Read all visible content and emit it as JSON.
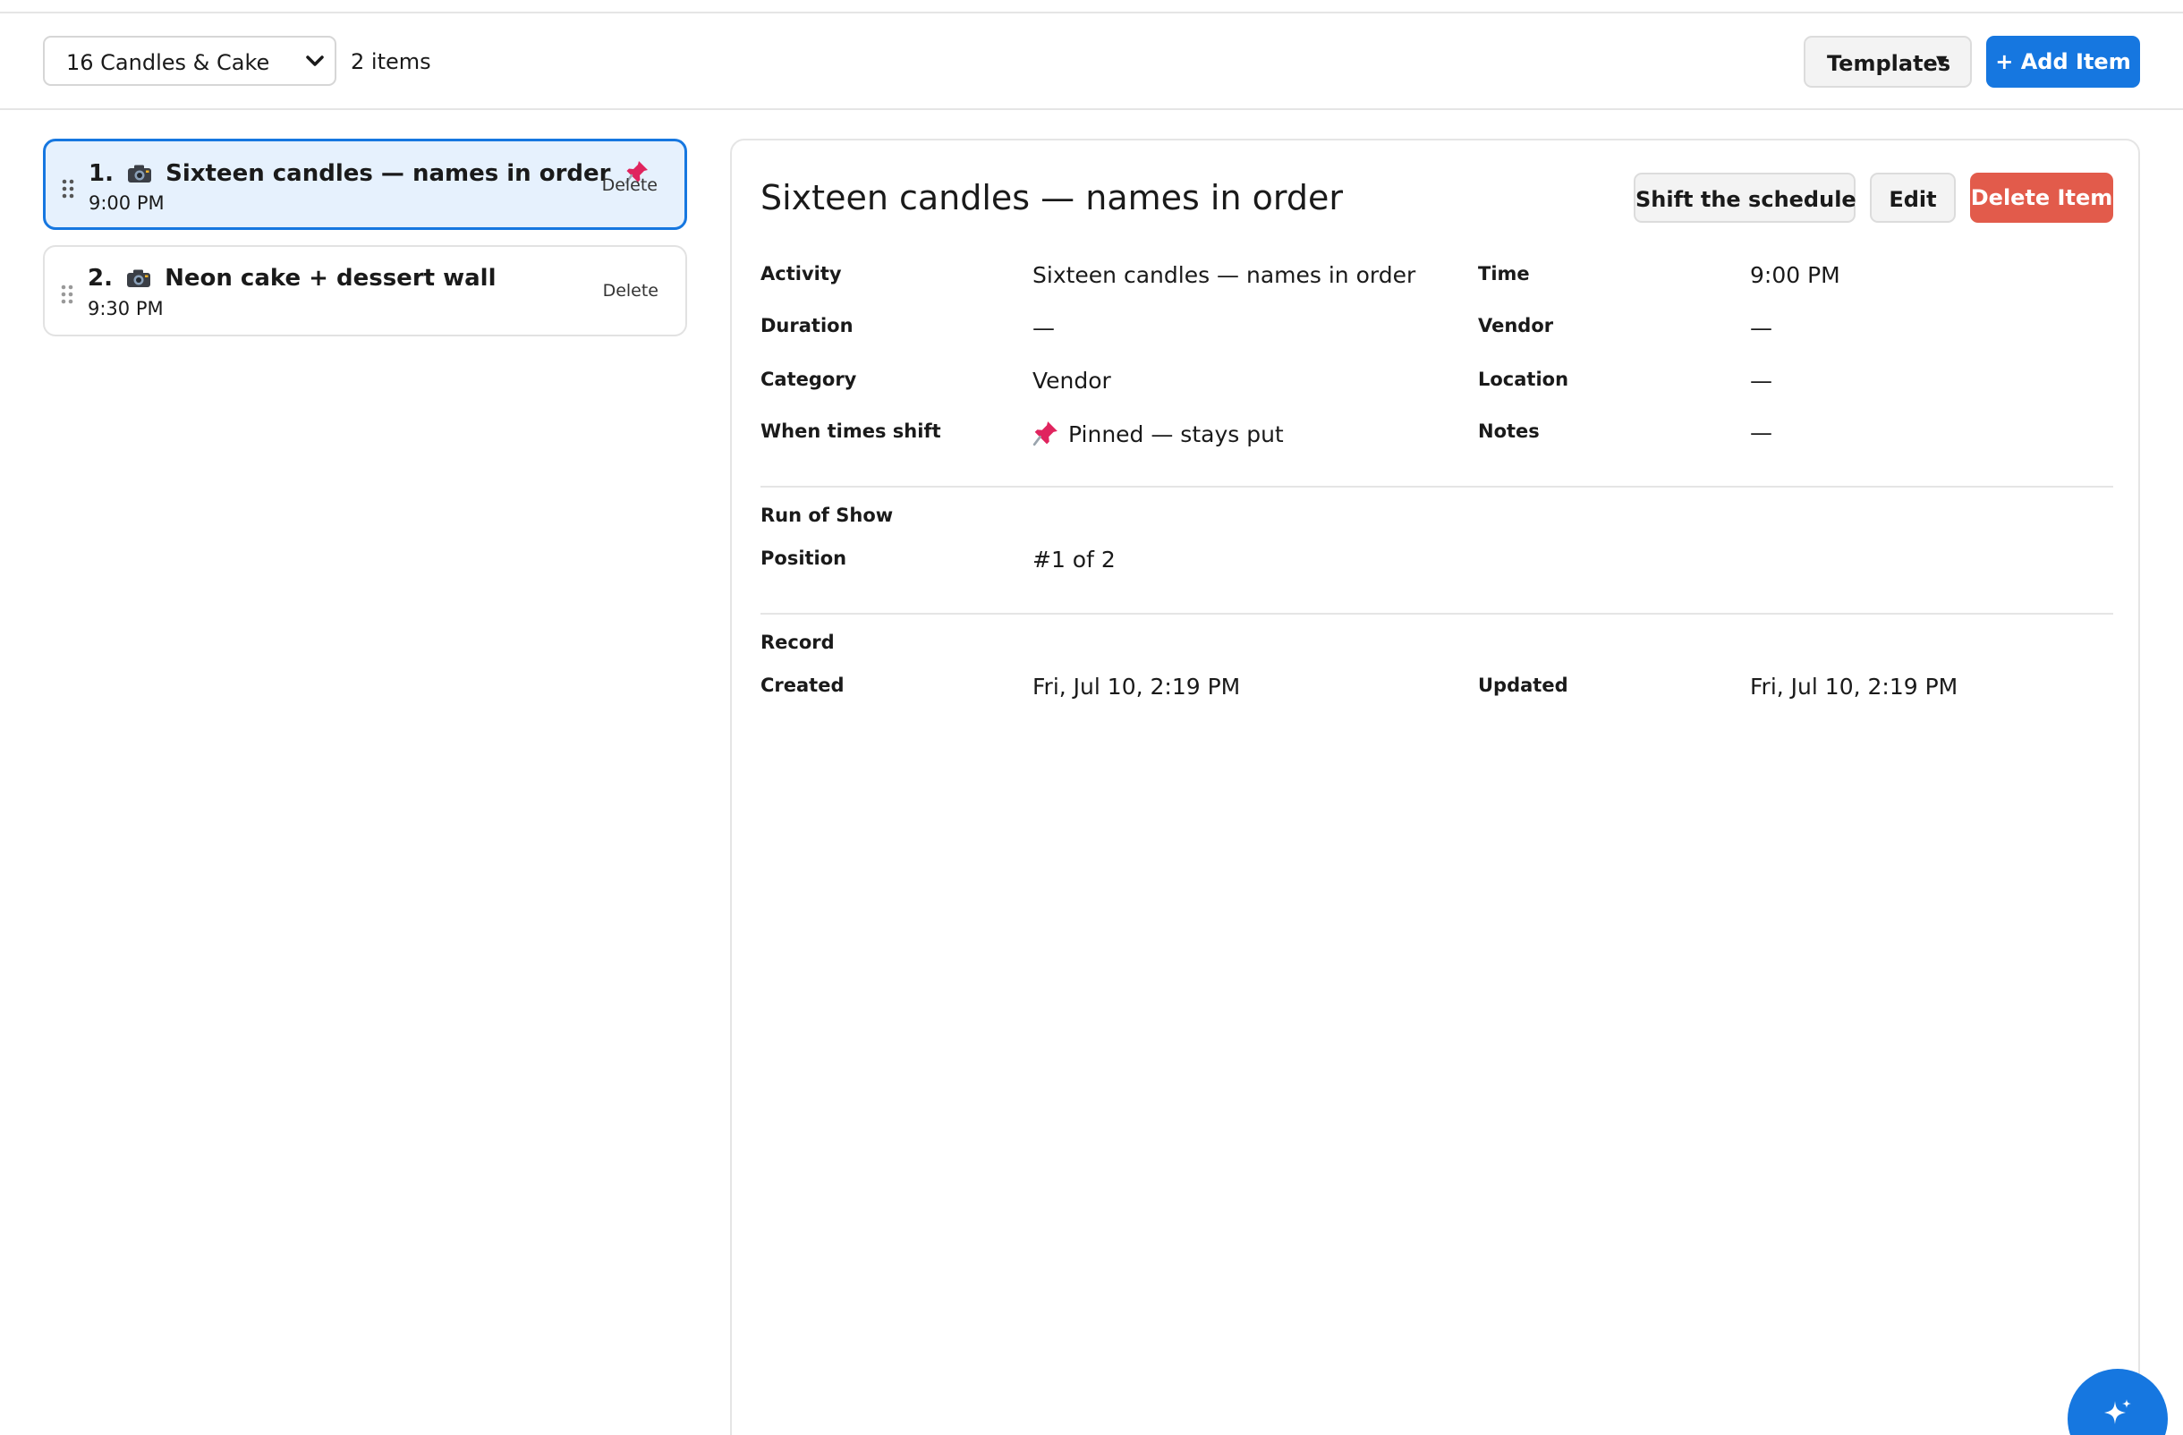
{
  "toolbar": {
    "event_select": "16 Candles & Cake",
    "item_count": "2 items",
    "templates_label": "Templates",
    "templates_caret": "▼",
    "add_label": "+ Add Item"
  },
  "items": [
    {
      "number": "1.",
      "title": "Sixteen candles — names in order",
      "time": "9:00 PM",
      "delete": "Delete",
      "icon": "camera-icon",
      "pinned": true
    },
    {
      "number": "2.",
      "title": "Neon cake + dessert wall",
      "time": "9:30 PM",
      "delete": "Delete",
      "icon": "camera-icon",
      "pinned": false
    }
  ],
  "detail": {
    "title": "Sixteen candles — names in order",
    "buttons": {
      "shift": "Shift the schedule",
      "edit": "Edit",
      "delete": "Delete Item"
    },
    "fields": {
      "activity_label": "Activity",
      "activity": "Sixteen candles — names in order",
      "time_label": "Time",
      "time": "9:00 PM",
      "duration_label": "Duration",
      "duration": "—",
      "vendor_label": "Vendor",
      "vendor": "—",
      "category_label": "Category",
      "category": "Vendor",
      "location_label": "Location",
      "location": "—",
      "shift_label": "When times shift",
      "shift": "Pinned — stays put",
      "notes_label": "Notes",
      "notes": "—"
    },
    "run_of_show": {
      "heading": "Run of Show",
      "position_label": "Position",
      "position": "#1 of 2"
    },
    "record": {
      "heading": "Record",
      "created_label": "Created",
      "created": "Fri, Jul 10, 2:19 PM",
      "updated_label": "Updated",
      "updated": "Fri, Jul 10, 2:19 PM"
    }
  },
  "colors": {
    "accent": "#1677e0",
    "danger": "#e25b4b",
    "selected_bg": "#e6f1fd",
    "pin": "#e0245e"
  },
  "icons": [
    "chevron-down-icon",
    "caret-down-icon",
    "drag-handle-icon",
    "camera-icon",
    "pin-icon",
    "sparkle-icon"
  ]
}
